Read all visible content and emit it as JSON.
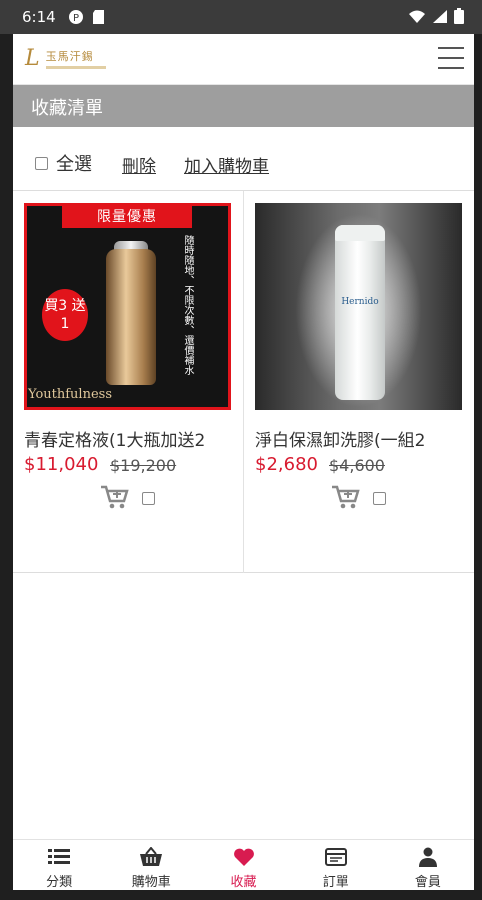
{
  "status_bar": {
    "time": "6:14",
    "icons": [
      "notification-icon",
      "sd-card-icon",
      "wifi-icon",
      "signal-icon",
      "battery-icon"
    ]
  },
  "header": {
    "logo_text": "玉馬汗錫",
    "menu_icon": "hamburger-icon"
  },
  "page_title": "收藏清單",
  "actions": {
    "select_all_label": "全選",
    "delete_label": "刪除",
    "add_to_cart_label": "加入購物車"
  },
  "products": [
    {
      "name": "青春定格液(1大瓶加送2",
      "price": "$11,040",
      "original_price": "$19,200",
      "image_banner": "限量優惠",
      "image_badge": "買3 送1",
      "image_caption": "隨時隨地、不限次數、還價補水",
      "image_brand": "Youthfulness"
    },
    {
      "name": "淨白保濕卸洗膠(一組2",
      "price": "$2,680",
      "original_price": "$4,600",
      "image_brand": "Hernido"
    }
  ],
  "tabs": [
    {
      "label": "分類",
      "icon": "list-icon",
      "active": false
    },
    {
      "label": "購物車",
      "icon": "basket-icon",
      "active": false
    },
    {
      "label": "收藏",
      "icon": "heart-icon",
      "active": true
    },
    {
      "label": "訂單",
      "icon": "order-icon",
      "active": false
    },
    {
      "label": "會員",
      "icon": "person-icon",
      "active": false
    }
  ],
  "colors": {
    "price_red": "#d81b30",
    "active_tab": "#d81b50",
    "title_bar": "#9e9e9e",
    "status_bar": "#3b3b3b"
  }
}
